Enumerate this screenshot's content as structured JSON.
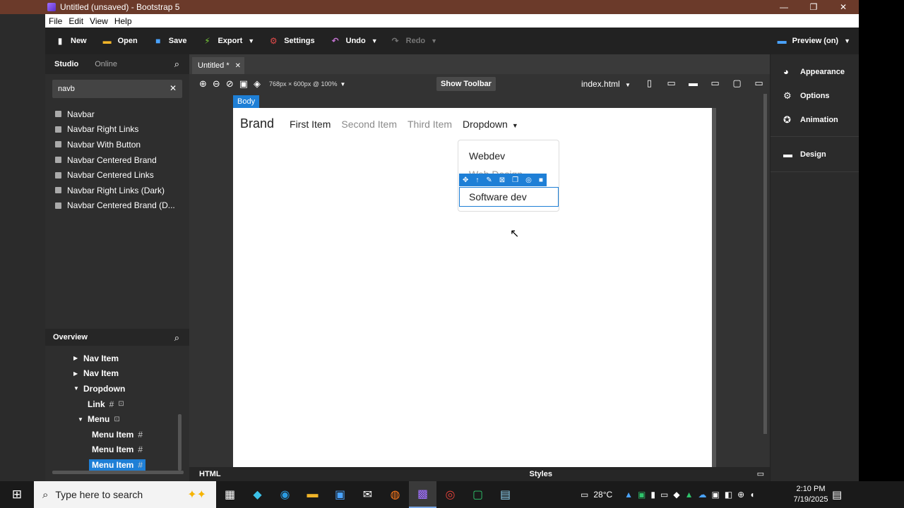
{
  "window": {
    "title": "Untitled (unsaved) - Bootstrap 5",
    "controls": [
      "—",
      "❐",
      "✕"
    ]
  },
  "menubar": [
    "File",
    "Edit",
    "View",
    "Help"
  ],
  "toolbar": {
    "new_label": "New",
    "open_label": "Open",
    "save_label": "Save",
    "export_label": "Export",
    "settings_label": "Settings",
    "undo_label": "Undo",
    "redo_label": "Redo",
    "preview_label": "Preview (on)"
  },
  "left": {
    "tab_studio": "Studio",
    "tab_online": "Online",
    "search_value": "navb",
    "components": [
      "Navbar",
      "Navbar Right Links",
      "Navbar With Button",
      "Navbar Centered Brand",
      "Navbar Centered Links",
      "Navbar Right Links (Dark)",
      "Navbar Centered Brand (D..."
    ],
    "overview_title": "Overview",
    "tree": [
      {
        "label": "Nav Item",
        "indent": 40,
        "arrow": "▶",
        "hash": "",
        "lock": false,
        "selected": false
      },
      {
        "label": "Nav Item",
        "indent": 40,
        "arrow": "▶",
        "hash": "",
        "lock": false,
        "selected": false
      },
      {
        "label": "Dropdown",
        "indent": 40,
        "arrow": "▼",
        "hash": "",
        "lock": false,
        "selected": false
      },
      {
        "label": "Link",
        "indent": 60,
        "arrow": "",
        "hash": "#",
        "lock": true,
        "selected": false
      },
      {
        "label": "Menu",
        "indent": 46,
        "arrow": "▼",
        "hash": "",
        "lock": true,
        "selected": false
      },
      {
        "label": "Menu Item",
        "indent": 66,
        "arrow": "",
        "hash": "#",
        "lock": false,
        "selected": false
      },
      {
        "label": "Menu Item",
        "indent": 66,
        "arrow": "",
        "hash": "#",
        "lock": false,
        "selected": false
      },
      {
        "label": "Menu Item",
        "indent": 62,
        "arrow": "",
        "hash": "#",
        "lock": false,
        "selected": true
      }
    ]
  },
  "center": {
    "doc_tab": "Untitled *",
    "size_label": "768px × 600px @ 100%",
    "show_toolbar": "Show Toolbar",
    "file_label": "index.html",
    "body_tag": "Body",
    "navbar": {
      "brand": "Brand",
      "first": "First Item",
      "second": "Second Item",
      "third": "Third Item",
      "dropdown": "Dropdown"
    },
    "dropdown_items": [
      "Webdev",
      "Web Design",
      "Software dev"
    ],
    "bottom_html": "HTML",
    "bottom_styles": "Styles"
  },
  "right": {
    "appearance": "Appearance",
    "options": "Options",
    "animation": "Animation",
    "design": "Design"
  },
  "taskbar": {
    "search_placeholder": "Type here to search",
    "weather": "28°C",
    "time": "2:10 PM",
    "date": "7/19/2025"
  },
  "colors": {
    "accent": "#1e7fd6",
    "titlebar": "#6b3a2a"
  }
}
